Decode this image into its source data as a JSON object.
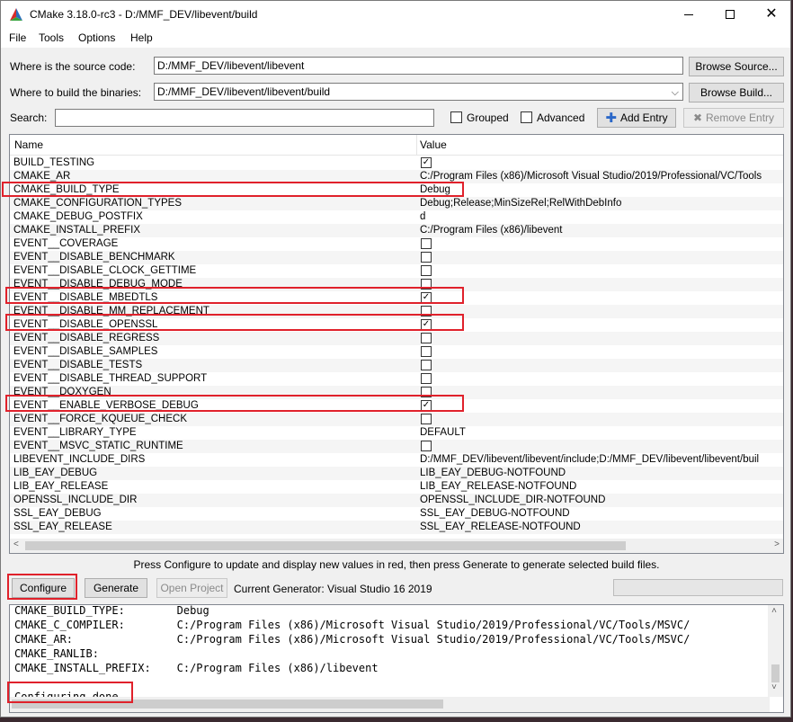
{
  "window": {
    "title": "CMake 3.18.0-rc3 - D:/MMF_DEV/libevent/build"
  },
  "menu": [
    "File",
    "Tools",
    "Options",
    "Help"
  ],
  "source": {
    "label": "Where is the source code:",
    "value": "D:/MMF_DEV/libevent/libevent",
    "button": "Browse Source..."
  },
  "build": {
    "label": "Where to build the binaries:",
    "value": "D:/MMF_DEV/libevent/libevent/build",
    "button": "Browse Build..."
  },
  "search": {
    "label": "Search:",
    "value": ""
  },
  "options": {
    "grouped": "Grouped",
    "advanced": "Advanced",
    "add_entry": "Add Entry",
    "remove_entry": "Remove Entry"
  },
  "table": {
    "headers": [
      "Name",
      "Value"
    ],
    "rows": [
      {
        "name": "BUILD_TESTING",
        "value": "",
        "checkbox": true,
        "checked": true
      },
      {
        "name": "CMAKE_AR",
        "value": "C:/Program Files (x86)/Microsoft Visual Studio/2019/Professional/VC/Tools",
        "checkbox": false,
        "checked": false
      },
      {
        "name": "CMAKE_BUILD_TYPE",
        "value": "Debug",
        "checkbox": false,
        "checked": false
      },
      {
        "name": "CMAKE_CONFIGURATION_TYPES",
        "value": "Debug;Release;MinSizeRel;RelWithDebInfo",
        "checkbox": false,
        "checked": false
      },
      {
        "name": "CMAKE_DEBUG_POSTFIX",
        "value": "d",
        "checkbox": false,
        "checked": false
      },
      {
        "name": "CMAKE_INSTALL_PREFIX",
        "value": "C:/Program Files (x86)/libevent",
        "checkbox": false,
        "checked": false
      },
      {
        "name": "EVENT__COVERAGE",
        "value": "",
        "checkbox": true,
        "checked": false
      },
      {
        "name": "EVENT__DISABLE_BENCHMARK",
        "value": "",
        "checkbox": true,
        "checked": false
      },
      {
        "name": "EVENT__DISABLE_CLOCK_GETTIME",
        "value": "",
        "checkbox": true,
        "checked": false
      },
      {
        "name": "EVENT__DISABLE_DEBUG_MODE",
        "value": "",
        "checkbox": true,
        "checked": false
      },
      {
        "name": "EVENT__DISABLE_MBEDTLS",
        "value": "",
        "checkbox": true,
        "checked": true
      },
      {
        "name": "EVENT__DISABLE_MM_REPLACEMENT",
        "value": "",
        "checkbox": true,
        "checked": false
      },
      {
        "name": "EVENT__DISABLE_OPENSSL",
        "value": "",
        "checkbox": true,
        "checked": true
      },
      {
        "name": "EVENT__DISABLE_REGRESS",
        "value": "",
        "checkbox": true,
        "checked": false
      },
      {
        "name": "EVENT__DISABLE_SAMPLES",
        "value": "",
        "checkbox": true,
        "checked": false
      },
      {
        "name": "EVENT__DISABLE_TESTS",
        "value": "",
        "checkbox": true,
        "checked": false
      },
      {
        "name": "EVENT__DISABLE_THREAD_SUPPORT",
        "value": "",
        "checkbox": true,
        "checked": false
      },
      {
        "name": "EVENT__DOXYGEN",
        "value": "",
        "checkbox": true,
        "checked": false
      },
      {
        "name": "EVENT__ENABLE_VERBOSE_DEBUG",
        "value": "",
        "checkbox": true,
        "checked": true
      },
      {
        "name": "EVENT__FORCE_KQUEUE_CHECK",
        "value": "",
        "checkbox": true,
        "checked": false
      },
      {
        "name": "EVENT__LIBRARY_TYPE",
        "value": "DEFAULT",
        "checkbox": false,
        "checked": false
      },
      {
        "name": "EVENT__MSVC_STATIC_RUNTIME",
        "value": "",
        "checkbox": true,
        "checked": false
      },
      {
        "name": "LIBEVENT_INCLUDE_DIRS",
        "value": "D:/MMF_DEV/libevent/libevent/include;D:/MMF_DEV/libevent/libevent/buil",
        "checkbox": false,
        "checked": false
      },
      {
        "name": "LIB_EAY_DEBUG",
        "value": "LIB_EAY_DEBUG-NOTFOUND",
        "checkbox": false,
        "checked": false
      },
      {
        "name": "LIB_EAY_RELEASE",
        "value": "LIB_EAY_RELEASE-NOTFOUND",
        "checkbox": false,
        "checked": false
      },
      {
        "name": "OPENSSL_INCLUDE_DIR",
        "value": "OPENSSL_INCLUDE_DIR-NOTFOUND",
        "checkbox": false,
        "checked": false
      },
      {
        "name": "SSL_EAY_DEBUG",
        "value": "SSL_EAY_DEBUG-NOTFOUND",
        "checkbox": false,
        "checked": false
      },
      {
        "name": "SSL_EAY_RELEASE",
        "value": "SSL_EAY_RELEASE-NOTFOUND",
        "checkbox": false,
        "checked": false
      }
    ]
  },
  "hint": "Press Configure to update and display new values in red, then press Generate to generate selected build files.",
  "actions": {
    "configure": "Configure",
    "generate": "Generate",
    "open_project": "Open Project",
    "generator": "Current Generator: Visual Studio 16 2019"
  },
  "output": {
    "lines": [
      "CMAKE_BUILD_TYPE:        Debug",
      "CMAKE_C_COMPILER:        C:/Program Files (x86)/Microsoft Visual Studio/2019/Professional/VC/Tools/MSVC/",
      "CMAKE_AR:                C:/Program Files (x86)/Microsoft Visual Studio/2019/Professional/VC/Tools/MSVC/",
      "CMAKE_RANLIB:",
      "CMAKE_INSTALL_PREFIX:    C:/Program Files (x86)/libevent",
      "",
      "Configuring done"
    ]
  },
  "colors": {
    "highlight": "#e0212b",
    "alt_row": "#f5f5f5",
    "window_bg": "#f0f0f0"
  }
}
